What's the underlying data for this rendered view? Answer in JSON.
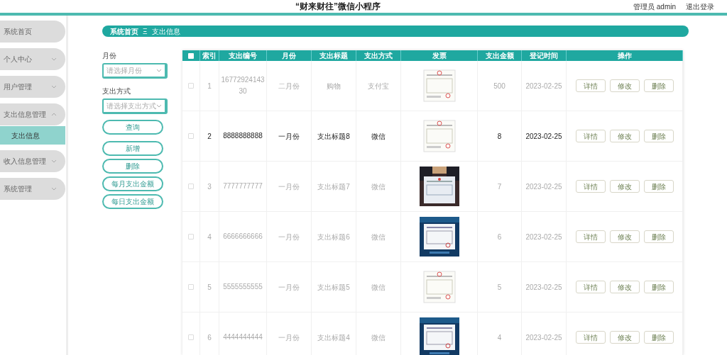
{
  "header": {
    "title": "“财来财往”微信小程序",
    "user": "管理员 admin",
    "logout": "退出登录"
  },
  "sidebar": {
    "items": [
      {
        "label": "系统首页"
      },
      {
        "label": "个人中心",
        "expanded": false
      },
      {
        "label": "用户管理",
        "expanded": false
      },
      {
        "label": "支出信息管理",
        "expanded": true,
        "children": [
          {
            "label": "支出信息",
            "selected": true
          }
        ]
      },
      {
        "label": "收入信息管理",
        "expanded": false
      },
      {
        "label": "系统管理",
        "expanded": false
      }
    ]
  },
  "breadcrumb": {
    "home": "系统首页",
    "separator": "Ξ",
    "current": "支出信息"
  },
  "filters": [
    {
      "label": "月份",
      "placeholder": "请选择月份"
    },
    {
      "label": "支出方式",
      "placeholder": "请选择支出方式"
    }
  ],
  "actions": [
    "查询",
    "新增",
    "删除",
    "每月支出金额",
    "每日支出金额"
  ],
  "table": {
    "columns": [
      "索引",
      "支出编号",
      "月份",
      "支出标题",
      "支出方式",
      "发票",
      "支出金额",
      "登记时间",
      "操作"
    ],
    "select_all": false,
    "rows": [
      {
        "index": "1",
        "number": "1677292414330",
        "month": "二月份",
        "title": "购物",
        "method": "支付宝",
        "amount": "500",
        "date": "2023-02-25",
        "checked": false,
        "highlighted": false,
        "actions": [
          "详情",
          "修改",
          "删除"
        ]
      },
      {
        "index": "2",
        "number": "8888888888",
        "month": "一月份",
        "title": "支出标题8",
        "method": "微信",
        "amount": "8",
        "date": "2023-02-25",
        "checked": false,
        "highlighted": true,
        "actions": [
          "详情",
          "修改",
          "删除"
        ]
      },
      {
        "index": "3",
        "number": "7777777777",
        "month": "一月份",
        "title": "支出标题7",
        "method": "微信",
        "amount": "7",
        "date": "2023-02-25",
        "checked": false,
        "highlighted": false,
        "actions": [
          "详情",
          "修改",
          "删除"
        ]
      },
      {
        "index": "4",
        "number": "6666666666",
        "month": "一月份",
        "title": "支出标题6",
        "method": "微信",
        "amount": "6",
        "date": "2023-02-25",
        "checked": false,
        "highlighted": false,
        "actions": [
          "详情",
          "修改",
          "删除"
        ]
      },
      {
        "index": "5",
        "number": "5555555555",
        "month": "一月份",
        "title": "支出标题5",
        "method": "微信",
        "amount": "5",
        "date": "2023-02-25",
        "checked": false,
        "highlighted": false,
        "actions": [
          "详情",
          "修改",
          "删除"
        ]
      },
      {
        "index": "6",
        "number": "4444444444",
        "month": "一月份",
        "title": "支出标题4",
        "method": "微信",
        "amount": "4",
        "date": "2023-02-25",
        "checked": false,
        "highlighted": false,
        "actions": [
          "详情",
          "修改",
          "删除"
        ]
      }
    ]
  }
}
